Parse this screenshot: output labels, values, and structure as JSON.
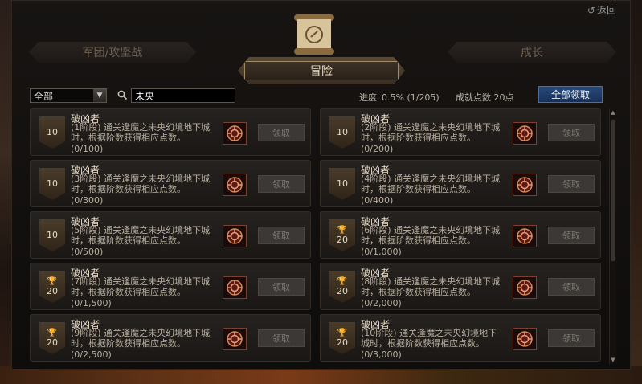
{
  "header": {
    "back_label": "返回"
  },
  "tabs": {
    "left": "军团/攻坚战",
    "active": "冒险",
    "right": "成长"
  },
  "filter": {
    "selected": "全部"
  },
  "search": {
    "value": "未央"
  },
  "summary": {
    "progress_label": "进度",
    "progress_value": "0.5% (1/205)",
    "points": "成就点数 20点",
    "claim_all": "全部领取"
  },
  "achievements": [
    {
      "title": "破凶者",
      "stage": "(1阶段)",
      "desc": "通关逢魔之未央幻境地下城时，根据阶数获得相应点数。",
      "progress": "(0/100)",
      "points": "10",
      "trophy": false,
      "claim": "领取"
    },
    {
      "title": "破凶者",
      "stage": "(2阶段)",
      "desc": "通关逢魔之未央幻境地下城时，根据阶数获得相应点数。",
      "progress": "(0/200)",
      "points": "10",
      "trophy": false,
      "claim": "领取"
    },
    {
      "title": "破凶者",
      "stage": "(3阶段)",
      "desc": "通关逢魔之未央幻境地下城时，根据阶数获得相应点数。",
      "progress": "(0/300)",
      "points": "10",
      "trophy": false,
      "claim": "领取"
    },
    {
      "title": "破凶者",
      "stage": "(4阶段)",
      "desc": "通关逢魔之未央幻境地下城时，根据阶数获得相应点数。",
      "progress": "(0/400)",
      "points": "10",
      "trophy": false,
      "claim": "领取"
    },
    {
      "title": "破凶者",
      "stage": "(5阶段)",
      "desc": "通关逢魔之未央幻境地下城时，根据阶数获得相应点数。",
      "progress": "(0/500)",
      "points": "10",
      "trophy": false,
      "claim": "领取"
    },
    {
      "title": "破凶者",
      "stage": "(6阶段)",
      "desc": "通关逢魔之未央幻境地下城时，根据阶数获得相应点数。",
      "progress": "(0/1,000)",
      "points": "20",
      "trophy": true,
      "claim": "领取"
    },
    {
      "title": "破凶者",
      "stage": "(7阶段)",
      "desc": "通关逢魔之未央幻境地下城时，根据阶数获得相应点数。",
      "progress": "(0/1,500)",
      "points": "20",
      "trophy": true,
      "claim": "领取"
    },
    {
      "title": "破凶者",
      "stage": "(8阶段)",
      "desc": "通关逢魔之未央幻境地下城时，根据阶数获得相应点数。",
      "progress": "(0/2,000)",
      "points": "20",
      "trophy": true,
      "claim": "领取"
    },
    {
      "title": "破凶者",
      "stage": "(9阶段)",
      "desc": "通关逢魔之未央幻境地下城时，根据阶数获得相应点数。",
      "progress": "(0/2,500)",
      "points": "20",
      "trophy": true,
      "claim": "领取"
    },
    {
      "title": "破凶者",
      "stage": "(10阶段)",
      "desc": "通关逢魔之未央幻境地下城时，根据阶数获得相应点数。",
      "progress": "(0/3,000)",
      "points": "20",
      "trophy": true,
      "claim": "领取"
    }
  ],
  "icons": {
    "back": "undo-arrow-icon",
    "search": "search-icon",
    "reward": "gear-emblem-icon",
    "trophy": "trophy-icon",
    "dropdown": "chevron-down-icon"
  }
}
